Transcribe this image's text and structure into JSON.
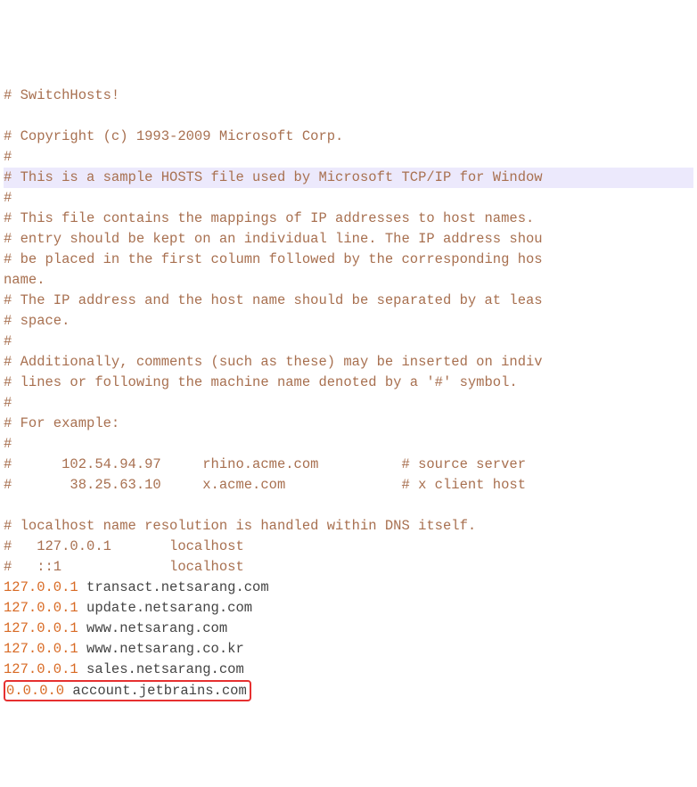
{
  "lines": {
    "l1": "# SwitchHosts!",
    "l2": "",
    "l3": "# Copyright (c) 1993-2009 Microsoft Corp.",
    "l4": "#",
    "l5": "# This is a sample HOSTS file used by Microsoft TCP/IP for Window",
    "l6": "#",
    "l7": "# This file contains the mappings of IP addresses to host names. ",
    "l8": "# entry should be kept on an individual line. The IP address shou",
    "l9": "# be placed in the first column followed by the corresponding hos",
    "l10": "name.",
    "l11": "# The IP address and the host name should be separated by at leas",
    "l12": "# space.",
    "l13": "#",
    "l14": "# Additionally, comments (such as these) may be inserted on indiv",
    "l15": "# lines or following the machine name denoted by a '#' symbol.",
    "l16": "#",
    "l17": "# For example:",
    "l18": "#",
    "l19": "#      102.54.94.97     rhino.acme.com          # source server",
    "l20": "#       38.25.63.10     x.acme.com              # x client host",
    "l21": "",
    "l22": "# localhost name resolution is handled within DNS itself.",
    "l23": "#   127.0.0.1       localhost",
    "l24": "#   ::1             localhost",
    "e1_ip": "127.0.0.1",
    "e1_host": " transact.netsarang.com",
    "e2_ip": "127.0.0.1",
    "e2_host": " update.netsarang.com",
    "e3_ip": "127.0.0.1",
    "e3_host": " www.netsarang.com",
    "e4_ip": "127.0.0.1",
    "e4_host": " www.netsarang.co.kr",
    "e5_ip": "127.0.0.1",
    "e5_host": " sales.netsarang.com",
    "e6_ip": "0.0.0.0",
    "e6_host": " account.jetbrains.com"
  }
}
